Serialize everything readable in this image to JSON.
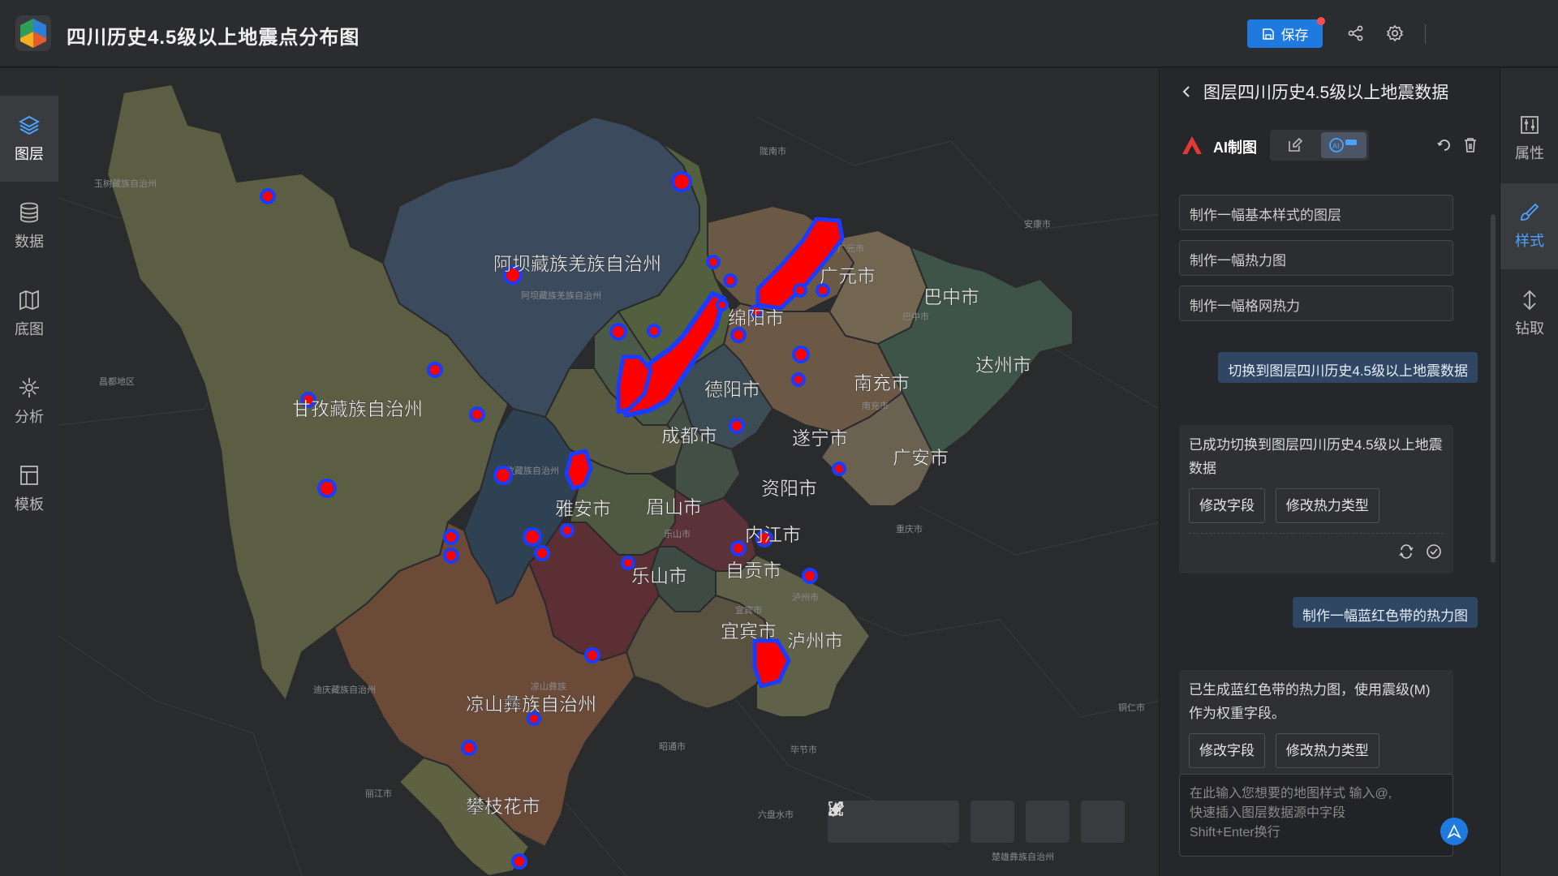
{
  "app": {
    "title": "四川历史4.5级以上地震点分布图",
    "save_label": "保存"
  },
  "left_nav": [
    {
      "label": "图层",
      "icon": "layers-icon",
      "active": true
    },
    {
      "label": "数据",
      "icon": "database-icon",
      "active": false
    },
    {
      "label": "底图",
      "icon": "basemap-icon",
      "active": false
    },
    {
      "label": "分析",
      "icon": "analysis-icon",
      "active": false
    },
    {
      "label": "模板",
      "icon": "template-icon",
      "active": false
    }
  ],
  "right_nav": [
    {
      "label": "属性",
      "icon": "properties-icon",
      "active": false
    },
    {
      "label": "样式",
      "icon": "style-brush-icon",
      "active": true
    },
    {
      "label": "钻取",
      "icon": "drill-icon",
      "active": false
    }
  ],
  "panel": {
    "title": "图层四川历史4.5级以上地震数据",
    "ai_label": "AI制图",
    "suggestions": [
      "制作一幅基本样式的图层",
      "制作一幅热力图",
      "制作一幅格网热力"
    ],
    "messages": [
      {
        "role": "user",
        "text": "切换到图层四川历史4.5级以上地震数据"
      },
      {
        "role": "bot",
        "text": "已成功切换到图层四川历史4.5级以上地震数据",
        "buttons": [
          "修改字段",
          "修改热力类型"
        ]
      },
      {
        "role": "user",
        "text": "制作一幅蓝红色带的热力图"
      },
      {
        "role": "bot",
        "text": "已生成蓝红色带的热力图，使用震级(M)作为权重字段。",
        "buttons": [
          "修改字段",
          "修改热力类型"
        ]
      }
    ],
    "input_placeholder": "在此输入您想要的地图样式 输入@,\n快速插入图层数据源中字段\nShift+Enter换行"
  },
  "map": {
    "regions": [
      {
        "name": "阿坝藏族羌族自治州",
        "color": "#3b4a5c"
      },
      {
        "name": "甘孜藏族自治州",
        "color": "#5b5e42"
      },
      {
        "name": "凉山彝族自治州",
        "color": "#6b4a38"
      },
      {
        "name": "攀枝花市",
        "color": "#5e6142"
      },
      {
        "name": "广元市",
        "color": "#6a5a45"
      },
      {
        "name": "巴中市",
        "color": "#736650"
      },
      {
        "name": "达州市",
        "color": "#3e5448"
      },
      {
        "name": "绵阳市",
        "color": "#52603f"
      },
      {
        "name": "南充市",
        "color": "#6b5845"
      },
      {
        "name": "德阳市",
        "color": "#4b5a48"
      },
      {
        "name": "遂宁市",
        "color": "#3c4c54"
      },
      {
        "name": "广安市",
        "color": "#6a6150"
      },
      {
        "name": "成都市",
        "color": "#595a42"
      },
      {
        "name": "资阳市",
        "color": "#434e45"
      },
      {
        "name": "雅安市",
        "color": "#2f4253"
      },
      {
        "name": "眉山市",
        "color": "#4f5840"
      },
      {
        "name": "内江市",
        "color": "#5a3238"
      },
      {
        "name": "乐山市",
        "color": "#5b2f33"
      },
      {
        "name": "自贡市",
        "color": "#3e4a44"
      },
      {
        "name": "宜宾市",
        "color": "#5a5240"
      },
      {
        "name": "泸州市",
        "color": "#5f6248"
      }
    ],
    "background_labels": [
      "玉树藏族自治州",
      "昌都地区",
      "陇南市",
      "安康市",
      "重庆市",
      "迪庆藏族自治州",
      "丽江市",
      "昭通市",
      "毕节市",
      "六盘水市",
      "铜仁市",
      "广元市",
      "巴中市",
      "阿坝藏族羌族自治州",
      "凉山彝族",
      "乐山市",
      "宜宾市",
      "泸州市",
      "南充市",
      "楚雄彝族自治州",
      "甘孜藏族自治州"
    ],
    "heat_color_low": "#1a3cff",
    "heat_color_high": "#ff0000"
  },
  "toolbar": {
    "zoom_in": "zoom-in-icon",
    "zoom_out": "zoom-out-icon",
    "compass": "compass-icon",
    "screenshot": "screenshot-icon",
    "measure": "ruler-icon",
    "edit": "edit-icon"
  }
}
